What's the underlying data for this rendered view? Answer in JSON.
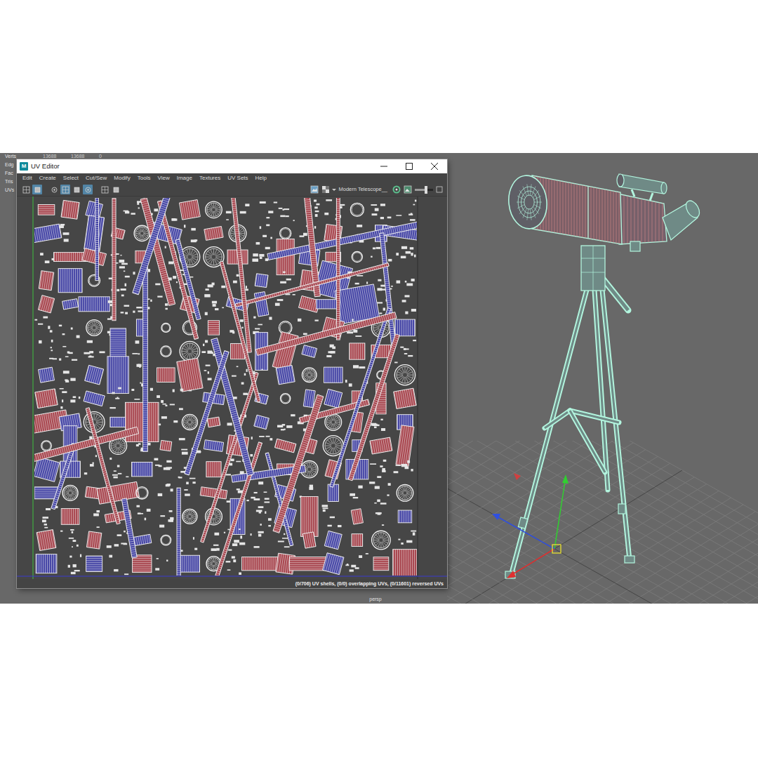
{
  "hud": {
    "rows": [
      {
        "label": "Verts",
        "values": [
          "13688",
          "13688",
          "0"
        ]
      },
      {
        "label": "Edg",
        "values": []
      },
      {
        "label": "Fac",
        "values": []
      },
      {
        "label": "Tris",
        "values": []
      },
      {
        "label": "UVs",
        "values": []
      }
    ]
  },
  "window": {
    "app_icon": "M",
    "title": "UV Editor"
  },
  "menu": [
    "Edit",
    "Create",
    "Select",
    "Cut/Sew",
    "Modify",
    "Tools",
    "View",
    "Image",
    "Textures",
    "UV Sets",
    "Help"
  ],
  "toolbar": {
    "toggles": [
      {
        "on": false
      },
      {
        "on": true
      },
      {
        "on": false
      },
      {
        "on": true
      },
      {
        "on": false
      },
      {
        "on": true
      },
      {
        "on": false
      },
      {
        "on": false
      }
    ],
    "uv_set": "Modern Telescope__",
    "slider": {
      "level": 0.6
    }
  },
  "status_bar": "(0/706) UV shells, (0/0) overlapping UVs, (0/11601) reversed UVs",
  "viewport": {
    "camera": "persp"
  }
}
